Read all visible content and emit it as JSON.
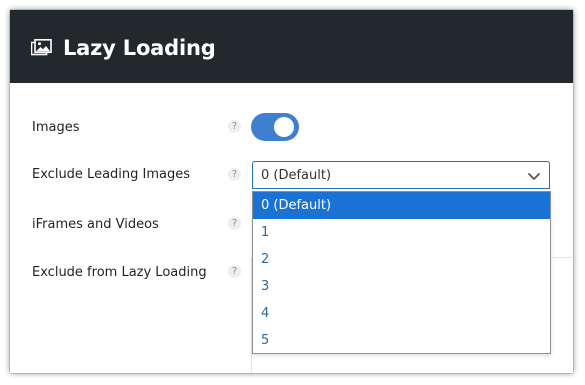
{
  "panel": {
    "title": "Lazy Loading",
    "icon": "images-icon"
  },
  "settings": {
    "images": {
      "label": "Images",
      "help": "?",
      "enabled": true
    },
    "exclude_leading_images": {
      "label": "Exclude Leading Images",
      "help": "?",
      "selected": "0 (Default)"
    },
    "iframes_videos": {
      "label": "iFrames and Videos",
      "help": "?"
    },
    "exclude_from_lazy": {
      "label": "Exclude from Lazy Loading",
      "help": "?"
    }
  },
  "dropdown": {
    "options": [
      "0 (Default)",
      "1",
      "2",
      "3",
      "4",
      "5"
    ],
    "selected_index": 0
  },
  "colors": {
    "header_bg": "#23282d",
    "toggle_on": "#3f7fd1",
    "option_highlight": "#1a73d4",
    "select_border": "#2271b1"
  }
}
